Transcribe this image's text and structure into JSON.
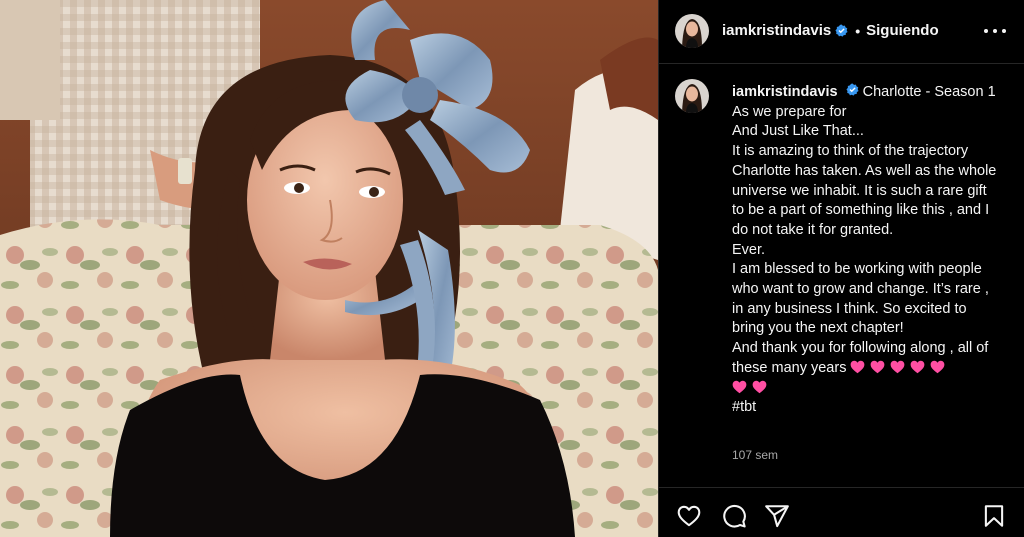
{
  "post": {
    "author": {
      "username": "iamkristindavis",
      "verified": true,
      "verified_color": "#3897f0"
    },
    "header": {
      "separator": "•",
      "follow_state": "Siguiendo",
      "more_icon": "more-horizontal-icon"
    },
    "caption": {
      "username": "iamkristindavis",
      "lines": [
        "Charlotte - Season 1",
        "As we prepare for",
        "And Just Like That...",
        "It is amazing to think of the trajectory Charlotte has taken. As well as the whole universe we inhabit. It is such a rare gift to be a part of something like this , and I do not take it for granted.",
        "Ever.",
        "I am blessed to be working with people who want to grow and change. It’s rare , in any business I think. So excited to bring you the next chapter!",
        "And thank you for following along , all of these many years"
      ],
      "hashtag": "#tbt",
      "heart_emoji_count": 7,
      "heart_color": "#ff4fa3"
    },
    "timestamp": "107 sem",
    "actions": {
      "like_icon": "heart-outline-icon",
      "comment_icon": "comment-bubble-icon",
      "share_icon": "paper-plane-icon",
      "save_icon": "bookmark-icon"
    },
    "colors": {
      "background": "#000000",
      "text": "#f5f5f5",
      "secondary_text": "#a8a8a8",
      "divider": "#262626"
    }
  }
}
